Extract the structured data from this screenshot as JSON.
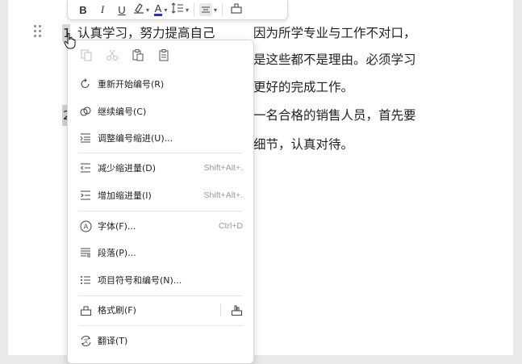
{
  "document": {
    "line1_num": "1",
    "line1_left": "认真学习，努力提高自己",
    "line1_right": "因为所学专业与工作不对口，",
    "line2": "是这些都不是理由。必须学习",
    "line3": "更好的完成工作。",
    "line4": "一名合格的销售人员，首先要",
    "line5": "细节，认真对待。",
    "line4_num": "2"
  },
  "toolbar": {
    "bold": "B",
    "italic": "I",
    "underline": "U",
    "font_color_letter": "A",
    "font_color": "#2a2ad8"
  },
  "menu": {
    "items": [
      {
        "label": "重新开始编号(R)",
        "icon": "restart-numbering-icon",
        "shortcut": ""
      },
      {
        "label": "继续编号(C)",
        "icon": "continue-numbering-icon",
        "shortcut": ""
      },
      {
        "label": "调整编号缩进(U)...",
        "icon": "adjust-indent-icon",
        "shortcut": ""
      },
      {
        "label": "减少缩进量(D)",
        "icon": "decrease-indent-icon",
        "shortcut": "Shift+Alt+."
      },
      {
        "label": "增加缩进量(I)",
        "icon": "increase-indent-icon",
        "shortcut": "Shift+Alt+."
      },
      {
        "label": "字体(F)...",
        "icon": "font-icon",
        "shortcut": "Ctrl+D"
      },
      {
        "label": "段落(P)...",
        "icon": "paragraph-icon",
        "shortcut": ""
      },
      {
        "label": "项目符号和编号(N)...",
        "icon": "bullets-numbering-icon",
        "shortcut": ""
      },
      {
        "label": "格式刷(F)",
        "icon": "format-painter-icon",
        "shortcut": ""
      },
      {
        "label": "翻译(T)",
        "icon": "translate-icon",
        "shortcut": ""
      }
    ]
  }
}
